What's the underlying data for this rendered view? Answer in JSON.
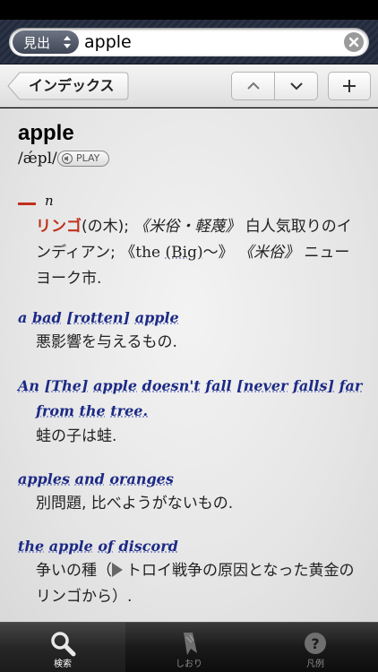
{
  "search": {
    "mode_label": "見出",
    "query": "apple"
  },
  "toolbar": {
    "index_label": "インデックス"
  },
  "entry": {
    "headword": "apple",
    "pronunciation": "/ǽpl/",
    "play_label": "PLAY",
    "pos_dash": "—",
    "pos": "n",
    "def_red": "リンゴ",
    "def_1": "(の木);",
    "def_region1": "《米俗・軽蔑》",
    "def_2": "白人気取りのインディアン;",
    "def_3a": "《the",
    "def_3b": "(Big)",
    "def_3c": "〜》",
    "def_region2": "《米俗》",
    "def_4": "ニューヨーク市."
  },
  "phrases": [
    {
      "p1_a": "a",
      "p1_b": "bad",
      "p1_c": "[rotten]",
      "p1_d": "apple",
      "meaning": "悪影響を与えるもの."
    },
    {
      "w1": "An",
      "w2": "[The]",
      "w3": "apple",
      "w4": "doesn't",
      "w5": "fall",
      "w6": "[never",
      "w7": "falls]",
      "w8": "far",
      "w9": "from",
      "w10": "the",
      "w11": "tree.",
      "meaning": "蛙の子は蛙."
    },
    {
      "w1": "apples",
      "w2": "and",
      "w3": "oranges",
      "meaning": "別問題, 比べようがないもの."
    },
    {
      "w1": "the",
      "w2": "apple",
      "w3": "of",
      "w4": "discord",
      "meaning_a": "争いの種（",
      "meaning_b": "トロイ戦争の原因となった黄金のリンゴから）."
    }
  ],
  "tabs": [
    {
      "label": "検索",
      "icon": "magnifier-icon"
    },
    {
      "label": "しおり",
      "icon": "bookmark-icon"
    },
    {
      "label": "凡例",
      "icon": "help-icon"
    }
  ]
}
